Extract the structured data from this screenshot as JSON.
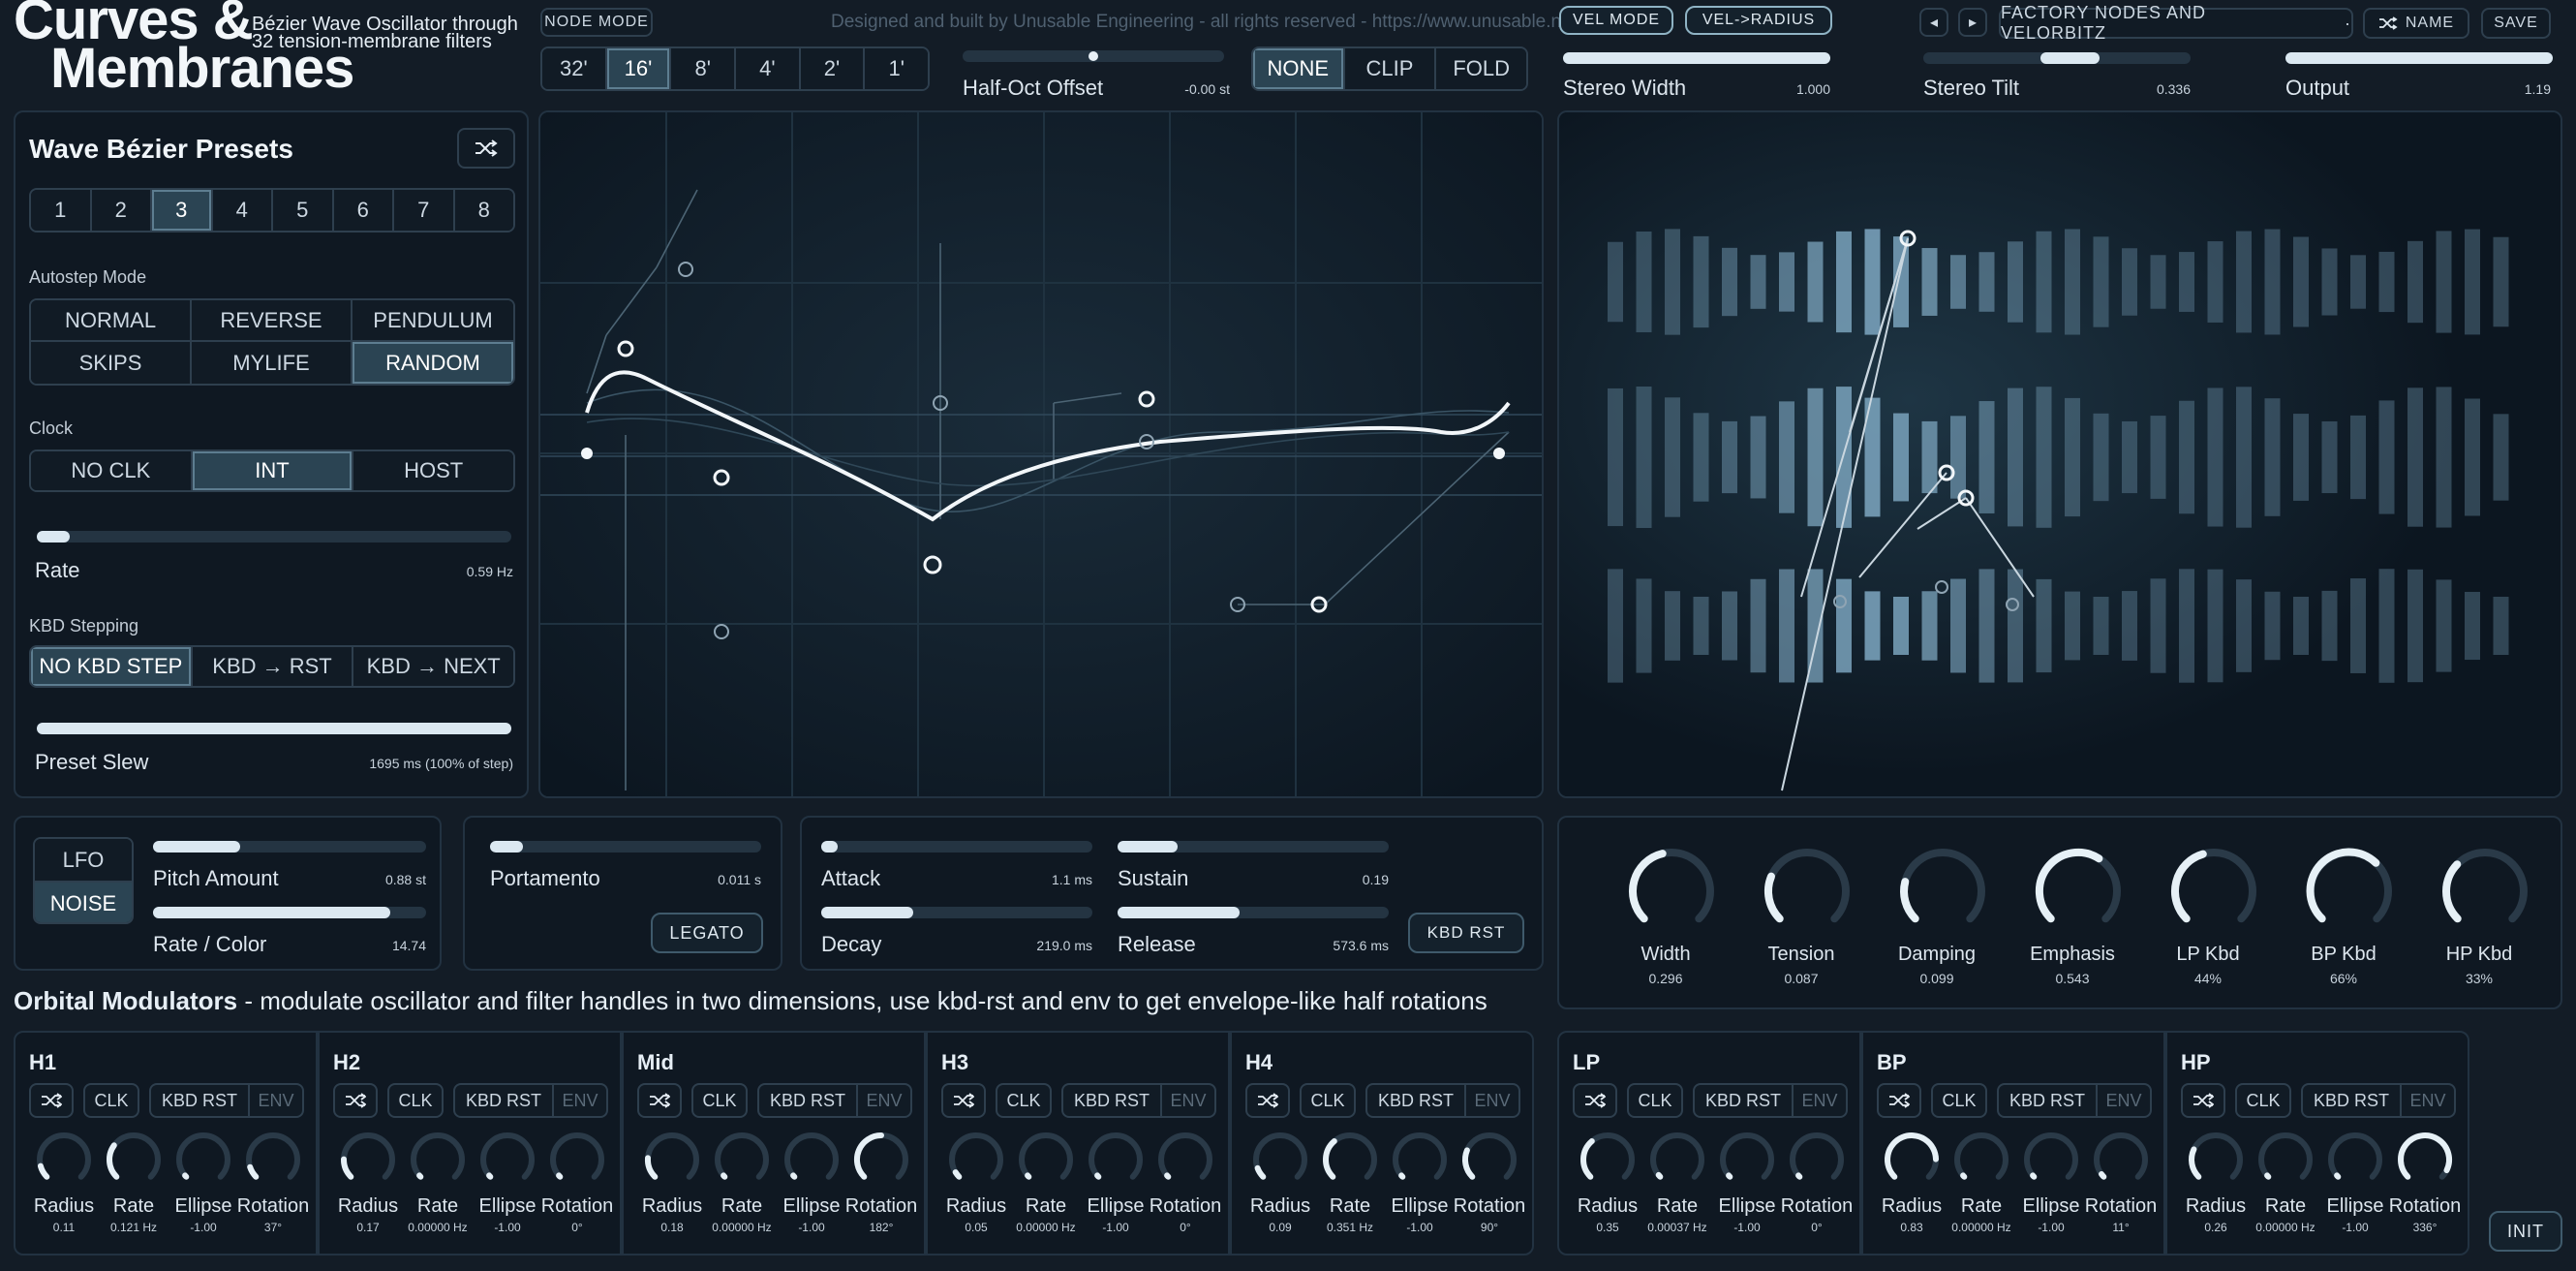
{
  "header": {
    "title_line1": "Curves &",
    "title_line2": "Membranes",
    "subtitle_line1": "Bézier Wave Oscillator through",
    "subtitle_line2": "32 tension-membrane filters",
    "credit": "Designed and built by Unusable Engineering - all rights reserved - https://www.unusable.net",
    "node_mode": "NODE MODE",
    "octaves": [
      "32'",
      "16'",
      "8'",
      "4'",
      "2'",
      "1'"
    ],
    "octave_selected": 1,
    "half_oct_label": "Half-Oct Offset",
    "half_oct_value": "-0.00 st",
    "half_oct_level": 0.5,
    "shaping": [
      "NONE",
      "CLIP",
      "FOLD"
    ],
    "shaping_selected": 0,
    "vel_mode": "VEL MODE",
    "vel_radius": "VEL->RADIUS",
    "stereo_width_label": "Stereo Width",
    "stereo_width_value": "1.000",
    "stereo_width_level": 1.0,
    "stereo_tilt_label": "Stereo Tilt",
    "stereo_tilt_value": "0.336",
    "stereo_tilt_level": 0.66,
    "output_label": "Output",
    "output_value": "1.19",
    "output_level": 1.0,
    "prev_icon": "◂",
    "next_icon": "▸",
    "preset_name": "FACTORY NODES AND VELORBITZ",
    "preset_dot": "·",
    "name_label": "NAME",
    "save_label": "SAVE"
  },
  "presets": {
    "title": "Wave Bézier Presets",
    "numbers": [
      "1",
      "2",
      "3",
      "4",
      "5",
      "6",
      "7",
      "8"
    ],
    "selected": 2,
    "autostep_label": "Autostep Mode",
    "autostep_modes": [
      "NORMAL",
      "REVERSE",
      "PENDULUM",
      "SKIPS",
      "MYLIFE",
      "RANDOM"
    ],
    "autostep_selected": 5,
    "clock_label": "Clock",
    "clock_modes": [
      "NO CLK",
      "INT",
      "HOST"
    ],
    "clock_selected": 1,
    "rate_label": "Rate",
    "rate_value": "0.59 Hz",
    "rate_level": 0.07,
    "kbd_label": "KBD Stepping",
    "kbd_modes": [
      "NO KBD STEP",
      "KBD → RST",
      "KBD → NEXT"
    ],
    "kbd_selected": 0,
    "slew_label": "Preset Slew",
    "slew_value": "1695 ms (100% of step)",
    "slew_level": 1.0
  },
  "modulation": {
    "lfo": "LFO",
    "noise": "NOISE",
    "lfo_selected": 1,
    "pitch_label": "Pitch Amount",
    "pitch_value": "0.88 st",
    "pitch_level": 0.32,
    "ratecolor_label": "Rate / Color",
    "ratecolor_value": "14.74",
    "ratecolor_level": 0.87,
    "portamento_label": "Portamento",
    "portamento_value": "0.011 s",
    "portamento_level": 0.12,
    "legato": "LEGATO",
    "attack_label": "Attack",
    "attack_value": "1.1 ms",
    "attack_level": 0.06,
    "sustain_label": "Sustain",
    "sustain_value": "0.19",
    "sustain_level": 0.22,
    "decay_label": "Decay",
    "decay_value": "219.0 ms",
    "decay_level": 0.34,
    "release_label": "Release",
    "release_value": "573.6 ms",
    "release_level": 0.45,
    "kbd_rst": "KBD RST"
  },
  "filter_knobs": [
    {
      "label": "Width",
      "value": "0.296",
      "level": 0.45
    },
    {
      "label": "Tension",
      "value": "0.087",
      "level": 0.25
    },
    {
      "label": "Damping",
      "value": "0.099",
      "level": 0.22
    },
    {
      "label": "Emphasis",
      "value": "0.543",
      "level": 0.62
    },
    {
      "label": "LP Kbd",
      "value": "44%",
      "level": 0.44
    },
    {
      "label": "BP Kbd",
      "value": "66%",
      "level": 0.66
    },
    {
      "label": "HP Kbd",
      "value": "33%",
      "level": 0.33
    }
  ],
  "orbital": {
    "title_bold": "Orbital Modulators",
    "title_rest": " - modulate oscillator and filter handles in two dimensions, use kbd-rst and env to get envelope-like half rotations",
    "clk": "CLK",
    "kbd_rst": "KBD RST",
    "env": "ENV",
    "shuffle_icon": "shuffle-icon",
    "param_labels": [
      "Radius",
      "Rate",
      "Ellipse",
      "Rotation"
    ],
    "init": "INIT",
    "modules": [
      {
        "name": "H1",
        "values": [
          "0.11",
          "0.121 Hz",
          "-1.00",
          "37°"
        ],
        "levels": [
          0.11,
          0.3,
          0.0,
          0.1
        ]
      },
      {
        "name": "H2",
        "values": [
          "0.17",
          "0.00000 Hz",
          "-1.00",
          "0°"
        ],
        "levels": [
          0.17,
          0.0,
          0.0,
          0.0
        ]
      },
      {
        "name": "Mid",
        "values": [
          "0.18",
          "0.00000 Hz",
          "-1.00",
          "182°"
        ],
        "levels": [
          0.18,
          0.0,
          0.0,
          0.5
        ]
      },
      {
        "name": "H3",
        "values": [
          "0.05",
          "0.00000 Hz",
          "-1.00",
          "0°"
        ],
        "levels": [
          0.05,
          0.0,
          0.0,
          0.0
        ]
      },
      {
        "name": "H4",
        "values": [
          "0.09",
          "0.351 Hz",
          "-1.00",
          "90°"
        ],
        "levels": [
          0.09,
          0.35,
          0.0,
          0.25
        ]
      },
      {
        "name": "LP",
        "values": [
          "0.35",
          "0.00037 Hz",
          "-1.00",
          "0°"
        ],
        "levels": [
          0.35,
          0.02,
          0.0,
          0.0
        ]
      },
      {
        "name": "BP",
        "values": [
          "0.83",
          "0.00000 Hz",
          "-1.00",
          "11°"
        ],
        "levels": [
          0.83,
          0.0,
          0.0,
          0.03
        ]
      },
      {
        "name": "HP",
        "values": [
          "0.26",
          "0.00000 Hz",
          "-1.00",
          "336°"
        ],
        "levels": [
          0.26,
          0.0,
          0.0,
          0.93
        ]
      }
    ]
  },
  "colors": {
    "background": "#131c26",
    "panel": "#0f1822",
    "accent": "#dbe8f1",
    "selected": "#2b4453"
  }
}
